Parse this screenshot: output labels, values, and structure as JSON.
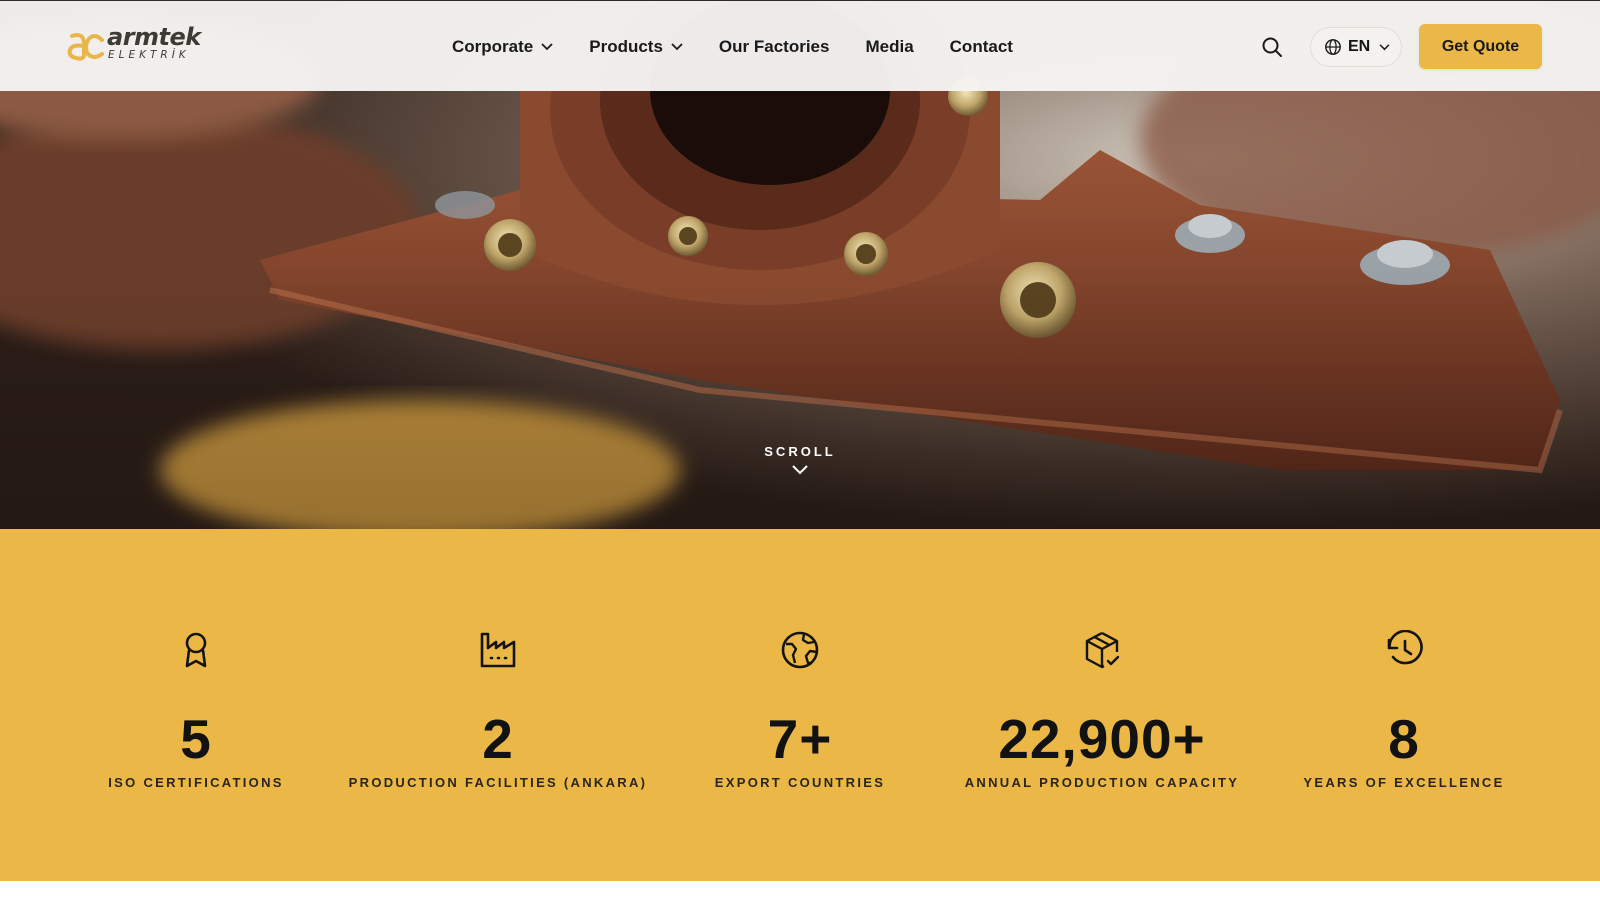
{
  "brand": {
    "name": "armtek",
    "sub": "ELEKTRİK"
  },
  "nav": {
    "items": [
      {
        "label": "Corporate",
        "dropdown": true
      },
      {
        "label": "Products",
        "dropdown": true
      },
      {
        "label": "Our Factories",
        "dropdown": false
      },
      {
        "label": "Media",
        "dropdown": false
      },
      {
        "label": "Contact",
        "dropdown": false
      }
    ]
  },
  "header": {
    "search_icon": "search-icon",
    "language": {
      "code": "EN",
      "icon": "globe-icon"
    },
    "cta_label": "Get Quote"
  },
  "hero": {
    "scroll_label": "SCROLL"
  },
  "stats": [
    {
      "icon": "award-ribbon-icon",
      "value": "5",
      "label": "ISO CERTIFICATIONS"
    },
    {
      "icon": "factory-icon",
      "value": "2",
      "label": "PRODUCTION FACILITIES (ANKARA)"
    },
    {
      "icon": "globe-map-icon",
      "value": "7+",
      "label": "EXPORT COUNTRIES"
    },
    {
      "icon": "package-check-icon",
      "value": "22,900+",
      "label": "ANNUAL PRODUCTION CAPACITY"
    },
    {
      "icon": "history-clock-icon",
      "value": "8",
      "label": "YEARS OF EXCELLENCE"
    }
  ],
  "colors": {
    "accent": "#ebb847",
    "text": "#141414",
    "header_bg": "#f6f5f3"
  }
}
